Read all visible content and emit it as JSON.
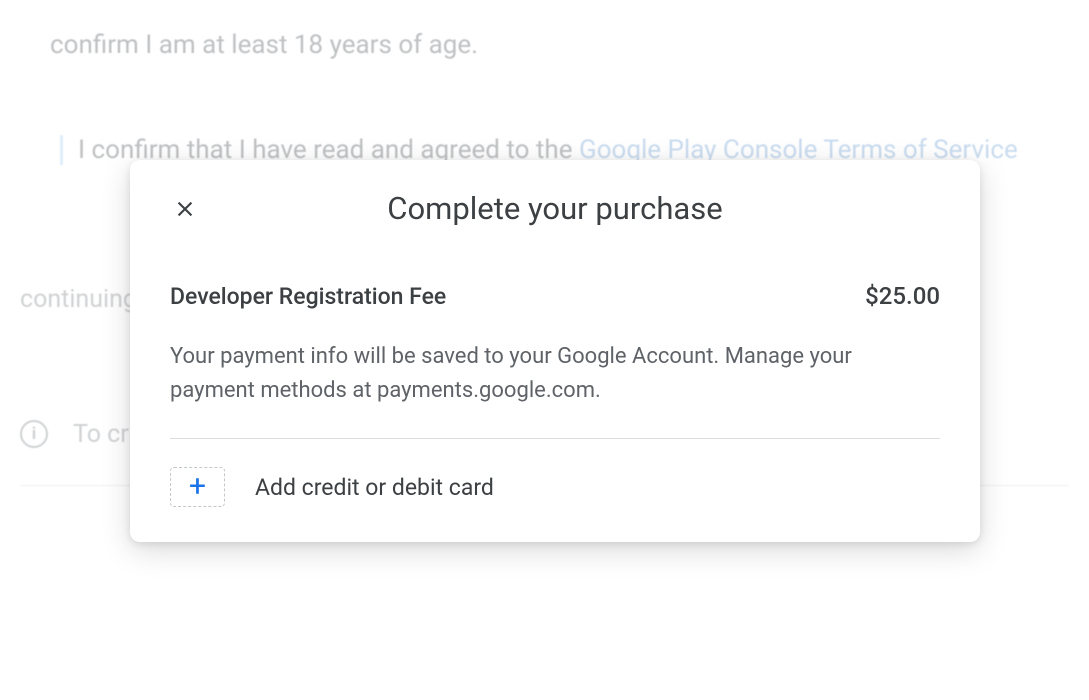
{
  "background": {
    "age_text": "confirm I am at least 18 years of age.",
    "terms_text_prefix": "I confirm that I have read and agreed to the ",
    "terms_link": "Google Play Console Terms of Service",
    "continuing_text": "continuing                                                                                                                                                              nisation / Jividual list                                                                                                                                                                    sole rms of Serv                                                                                                                                                               reements behalf of t",
    "info_text": "To cr                                                                                                                                                                       be aske                                                                                                                                                                             we can't verify your identity, the registration fee won't be refunded."
  },
  "modal": {
    "title": "Complete your purchase",
    "fee_label": "Developer Registration Fee",
    "fee_amount": "$25.00",
    "payment_info": "Your payment info will be saved to your Google Account. Manage your payment methods at payments.google.com.",
    "add_card_label": "Add credit or debit card"
  }
}
